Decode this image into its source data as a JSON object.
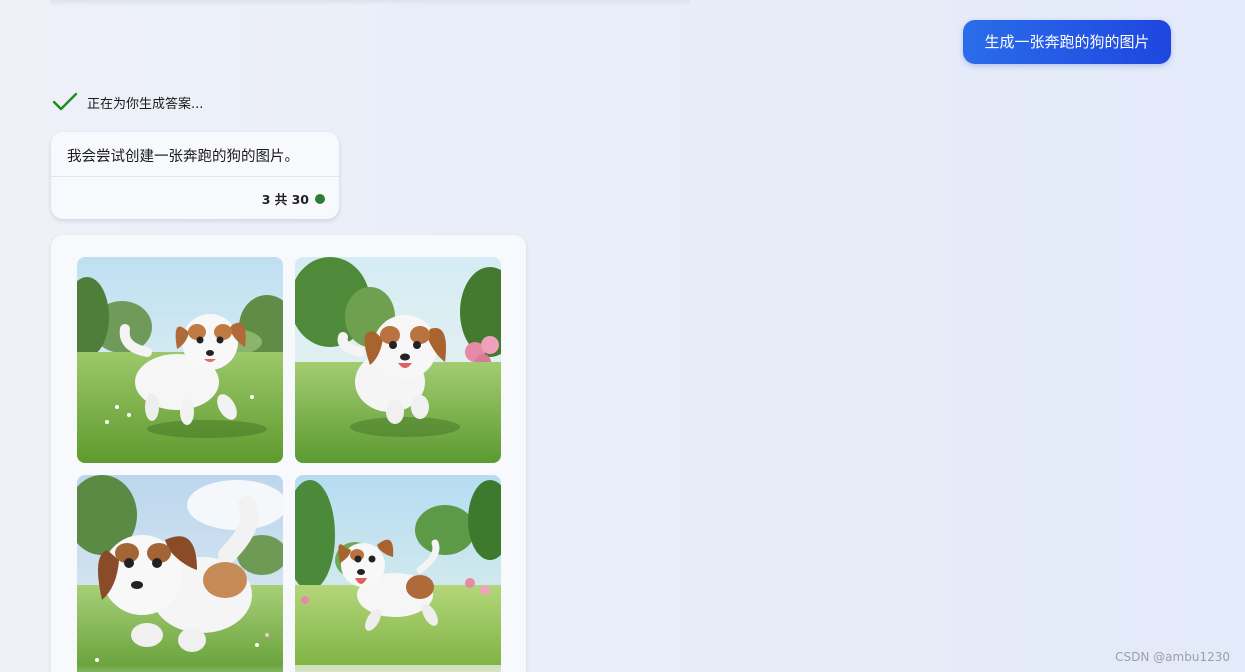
{
  "chat": {
    "user_message": "生成一张奔跑的狗的图片",
    "status_text": "正在为你生成答案...",
    "bot_message": "我会尝试创建一张奔跑的狗的图片。",
    "turn_counter": "3 共 30",
    "status_icon": "check-icon",
    "colors": {
      "user_bubble": "#2a6de9",
      "check": "#1f8a1f",
      "counter_dot": "#2e7d32"
    }
  },
  "images": [
    {
      "icon": "image-puppy-running-1"
    },
    {
      "icon": "image-puppy-running-2"
    },
    {
      "icon": "image-puppy-running-3"
    },
    {
      "icon": "image-puppy-running-4"
    }
  ],
  "watermark": "CSDN @ambu1230"
}
